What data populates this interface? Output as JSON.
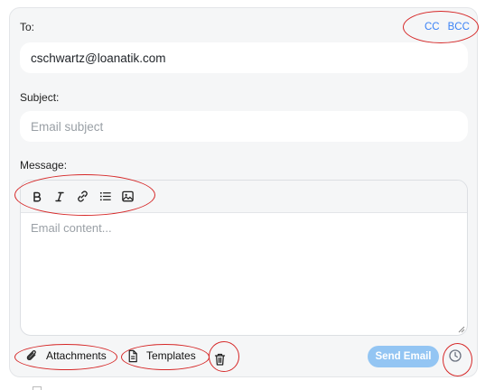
{
  "to": {
    "label": "To:",
    "value": "cschwartz@loanatik.com"
  },
  "recipients": {
    "cc_label": "CC",
    "bcc_label": "BCC"
  },
  "subject": {
    "label": "Subject:",
    "placeholder": "Email subject"
  },
  "message": {
    "label": "Message:",
    "placeholder": "Email content...",
    "toolbar": [
      "bold-icon",
      "italic-icon",
      "link-icon",
      "list-icon",
      "image-icon"
    ]
  },
  "actions": {
    "attachments_label": "Attachments",
    "templates_label": "Templates",
    "send_label": "Send Email",
    "delete_icon": "trash-icon",
    "schedule_icon": "clock-icon"
  },
  "colors": {
    "accent": "#3b82f6",
    "send_disabled": "#93c5f3",
    "annotation": "#d62828",
    "panel_bg": "#f5f6f7"
  }
}
